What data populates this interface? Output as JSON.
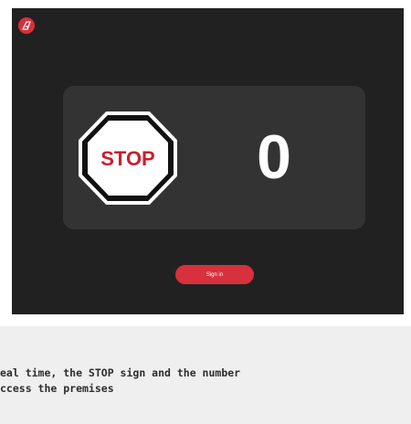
{
  "app": {
    "logo_icon": "brand-logo-icon",
    "accent_color": "#d6313d"
  },
  "status_panel": {
    "sign_text": "STOP",
    "sign_icon": "stop-sign-icon",
    "counter_value": "0"
  },
  "actions": {
    "signin_label": "Sign in"
  },
  "caption": {
    "line1": "eal time, the STOP sign and the number",
    "line2": "ccess the premises"
  }
}
